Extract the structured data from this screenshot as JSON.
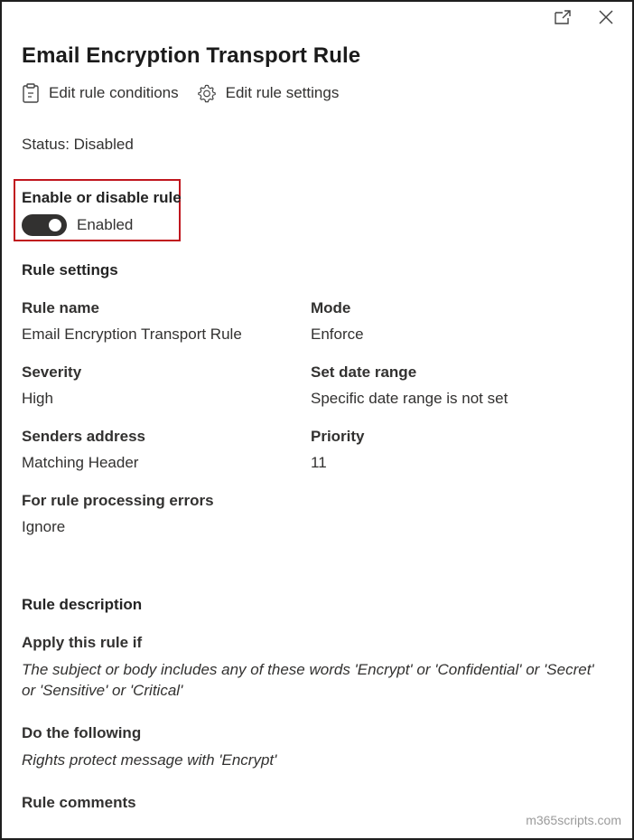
{
  "panel": {
    "title": "Email Encryption Transport Rule",
    "actions": {
      "edit_conditions": "Edit rule conditions",
      "edit_settings": "Edit rule settings"
    },
    "status": "Status: Disabled",
    "toggle": {
      "label": "Enable or disable rule",
      "state_text": "Enabled",
      "on": true
    },
    "icons": {
      "popout": "popout-icon",
      "close": "close-icon",
      "clipboard": "clipboard-icon",
      "gear": "gear-icon"
    }
  },
  "rule_settings": {
    "heading": "Rule settings",
    "rule_name_label": "Rule name",
    "rule_name_value": "Email Encryption Transport Rule",
    "mode_label": "Mode",
    "mode_value": "Enforce",
    "severity_label": "Severity",
    "severity_value": "High",
    "date_range_label": "Set date range",
    "date_range_value": "Specific date range is not set",
    "senders_label": "Senders address",
    "senders_value": "Matching Header",
    "priority_label": "Priority",
    "priority_value": "11",
    "errors_label": "For rule processing errors",
    "errors_value": "Ignore"
  },
  "rule_description": {
    "heading": "Rule description",
    "apply_label": "Apply this rule if",
    "apply_value": "The subject or body includes any of these words 'Encrypt' or 'Confidential' or 'Secret' or 'Sensitive' or 'Critical'",
    "do_label": "Do the following",
    "do_value": "Rights protect message with 'Encrypt'",
    "comments_heading": "Rule comments"
  },
  "watermark": "m365scripts.com",
  "colors": {
    "highlight": "#c0161e",
    "toggle_on": "#323130",
    "text": "#242424"
  }
}
